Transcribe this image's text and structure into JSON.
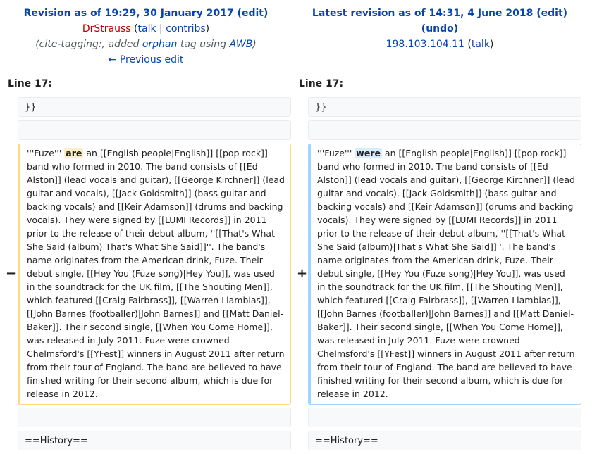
{
  "left_header": {
    "title": "Revision as of 19:29, 30 January 2017",
    "paren_open": " (",
    "edit": "edit",
    "paren_close": ")",
    "user": "DrStrauss",
    "talk": "talk",
    "sep": "|",
    "contribs": "contribs",
    "summary_prefix": "(cite-tagging:, added ",
    "summary_link1": "orphan",
    "summary_mid": " tag using ",
    "summary_link2": "AWB",
    "summary_suffix": ")",
    "previous_edit": "← Previous edit"
  },
  "right_header": {
    "title": "Latest revision as of 14:31, 4 June 2018",
    "paren_open": " (",
    "edit": "edit",
    "paren_close": ")",
    "undo_open": "(",
    "undo": "undo",
    "undo_close": ")",
    "user": "198.103.104.11",
    "talk": "talk"
  },
  "line_label_left": "Line 17:",
  "line_label_right": "Line 17:",
  "context_top": "}}",
  "context_bottom": "==History==",
  "marker_minus": "−",
  "marker_plus": "+",
  "diff": {
    "prefix": "'''Fuze''' ",
    "removed_word": "are",
    "added_word": "were",
    "body": " an [[English people|English]] [[pop rock]] band who formed in 2010. The band consists of [[Ed Alston]] (lead vocals and guitar), [[George Kirchner]] (lead guitar and vocals), [[Jack Goldsmith]] (bass guitar and backing vocals) and [[Keir Adamson]] (drums and backing vocals). They were signed by [[LUMI Records]] in 2011 prior to the release of their debut album, ''[[That's What She Said (album)|That's What She Said]]''. The band's name originates from the American drink, Fuze. Their debut single, [[Hey You (Fuze song)|Hey You]], was used in the soundtrack for the UK film, [[The Shouting Men]], which featured [[Craig Fairbrass]], [[Warren Llambias]], [[John Barnes (footballer)|John Barnes]] and [[Matt Daniel-Baker]]. Their second single, [[When You Come Home]], was released in July 2011. Fuze were crowned Chelmsford's [[YFest]] winners in August 2011 after return from their tour of England. The band are believed to have finished writing for their second album, which is due for release in 2012."
  }
}
